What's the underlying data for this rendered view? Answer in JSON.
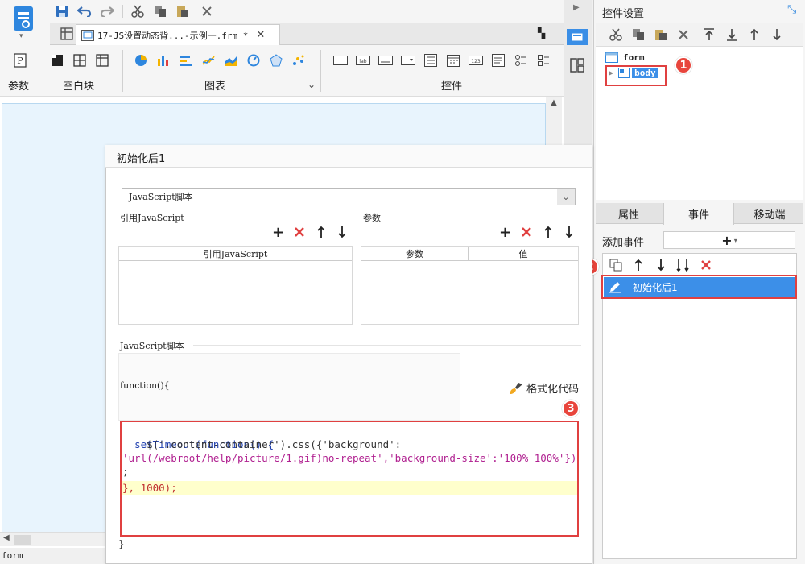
{
  "toolbar": {
    "tab_title": "17-JS设置动态背...-示例一.frm *",
    "groups": {
      "param": "参数",
      "blank_block": "空白块",
      "chart": "图表",
      "widget": "控件"
    }
  },
  "right_panel": {
    "title": "控件设置",
    "tree": {
      "root": "form",
      "child": "body"
    },
    "tabs": [
      "属性",
      "事件",
      "移动端"
    ],
    "add_event_label": "添加事件",
    "event_item": "初始化后1"
  },
  "dialog": {
    "title": "初始化后1",
    "script_type": "JavaScript脚本",
    "ref_js_label": "引用JavaScript",
    "param_label": "参数",
    "ref_js_col": "引用JavaScript",
    "param_cols": [
      "参数",
      "值"
    ],
    "script_label": "JavaScript脚本",
    "func_header": "function(){",
    "format_code_label": "格式化代码",
    "code_lines": [
      "setTimeout(function() {",
      "    $('.content-container').css({'background':",
      "'url(/webroot/help/picture/1.gif)no-repeat','background-size':'100% 100%'})",
      ";",
      "}, 1000);"
    ],
    "func_footer": "}"
  },
  "badges": [
    "1",
    "2",
    "3"
  ],
  "status_bar": "form",
  "colors": {
    "accent": "#3a8ee6",
    "annotation": "#e04040",
    "selected_row": "#3c8fe8",
    "highlight_line": "#ffffcc"
  }
}
